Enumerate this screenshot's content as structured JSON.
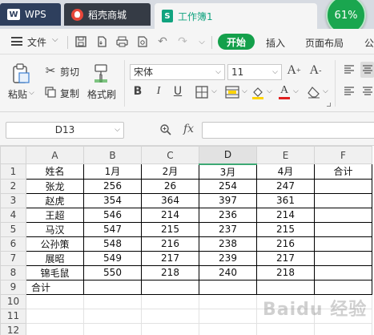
{
  "titlebar": {
    "tabs": [
      {
        "label": "WPS",
        "icon": "wps-logo-icon"
      },
      {
        "label": "稻壳商城",
        "icon": "docer-mall-icon"
      },
      {
        "label": "工作簿1",
        "icon": "spreadsheet-icon"
      }
    ],
    "progress_badge": "61%"
  },
  "menubar": {
    "file_label": "文件",
    "start_label": "开始",
    "items": [
      "插入",
      "页面布局",
      "公"
    ]
  },
  "ribbon": {
    "paste_label": "粘贴",
    "cut_label": "剪切",
    "copy_label": "复制",
    "format_painter_label": "格式刷",
    "font_name": "宋体",
    "font_size": "11",
    "bold": "B",
    "italic": "I",
    "underline": "U",
    "font_color": "A",
    "grow_font": "A⁺",
    "shrink_font": "A⁻"
  },
  "formulabar": {
    "name_box": "D13",
    "fx_label": "fx",
    "formula_value": ""
  },
  "sheet": {
    "selected_column": "D",
    "columns": [
      "A",
      "B",
      "C",
      "D",
      "E",
      "F"
    ],
    "rows": [
      [
        "姓名",
        "1月",
        "2月",
        "3月",
        "4月",
        "合计"
      ],
      [
        "张龙",
        "256",
        "26",
        "254",
        "247",
        ""
      ],
      [
        "赵虎",
        "354",
        "364",
        "397",
        "361",
        ""
      ],
      [
        "王超",
        "546",
        "214",
        "236",
        "214",
        ""
      ],
      [
        "马汉",
        "547",
        "215",
        "237",
        "215",
        ""
      ],
      [
        "公孙策",
        "548",
        "216",
        "238",
        "216",
        ""
      ],
      [
        "展昭",
        "549",
        "217",
        "239",
        "217",
        ""
      ],
      [
        "锦毛鼠",
        "550",
        "218",
        "240",
        "218",
        ""
      ],
      [
        "合计",
        "",
        "",
        "",
        "",
        ""
      ],
      [
        "",
        "",
        "",
        "",
        "",
        ""
      ],
      [
        "",
        "",
        "",
        "",
        "",
        ""
      ],
      [
        "",
        "",
        "",
        "",
        "",
        ""
      ]
    ],
    "row_numbers": [
      "1",
      "2",
      "3",
      "4",
      "5",
      "6",
      "7",
      "8",
      "9",
      "10",
      "11",
      "12"
    ]
  },
  "watermark": "Baidu 经验",
  "colors": {
    "accent": "#14a04b",
    "title_dark": "#2e3f5d",
    "sheet_green": "#11a37f"
  }
}
